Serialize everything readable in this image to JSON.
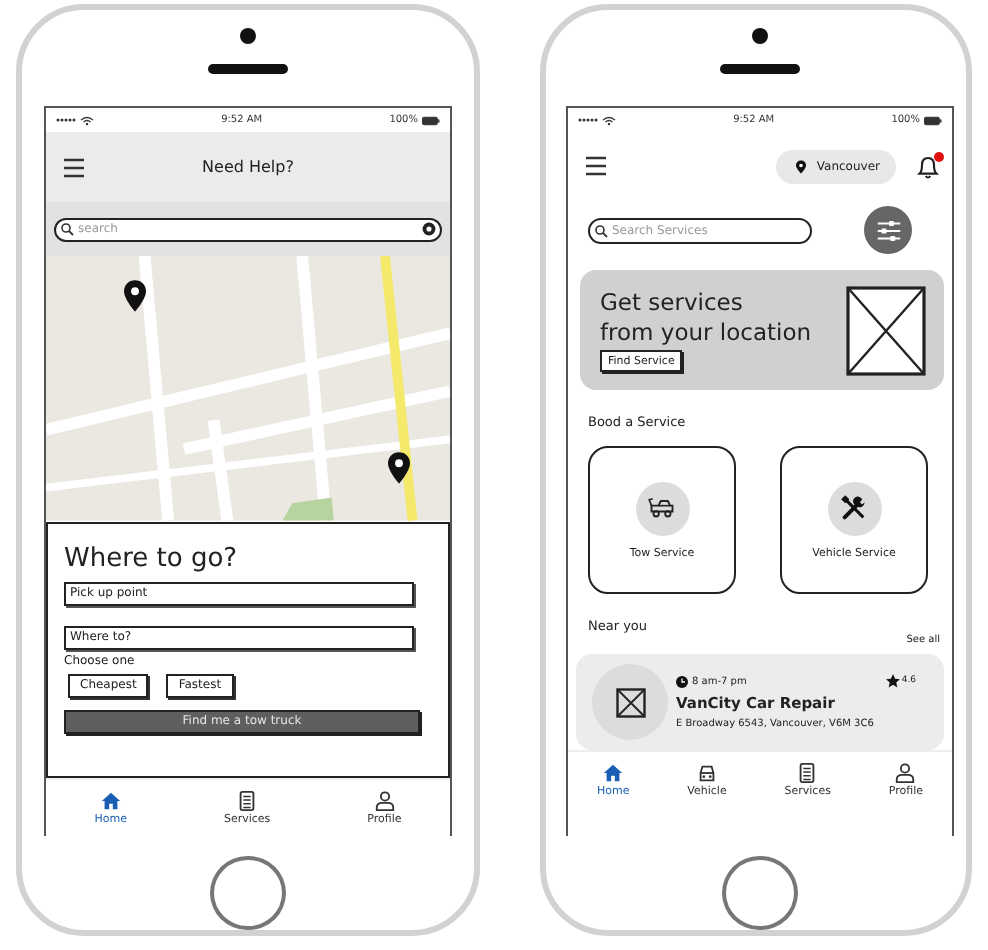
{
  "phones": [
    {
      "kind": "find_truck",
      "status_bar": {
        "time": "9:52 AM",
        "battery": "100%"
      },
      "title": "Need Help?",
      "search": {
        "placeholder": "search"
      },
      "sheet": {
        "heading": "Where to go?",
        "fields": [
          {
            "placeholder": "Pick up point"
          },
          {
            "placeholder": "Where to?"
          }
        ],
        "choice_label": "Choose one",
        "options": [
          "Cheapest",
          "Fastest"
        ],
        "action": "Find me a tow truck"
      },
      "nav": [
        {
          "kind": "home",
          "label": "Home",
          "selected": true
        },
        {
          "kind": "services",
          "label": "Services",
          "selected": false
        },
        {
          "kind": "profile",
          "label": "Profile",
          "selected": false
        }
      ]
    },
    {
      "kind": "services",
      "status_bar": {
        "time": "9:52 AM",
        "battery": "100%"
      },
      "location": "Vancouver",
      "notification": true,
      "search": {
        "placeholder": "Search Services"
      },
      "banner": {
        "heading_lines": [
          "Get services",
          "from your location"
        ],
        "button": "Find Service"
      },
      "section_title": "Bood a Service",
      "services": [
        {
          "kind": "tow",
          "label": "Tow Service"
        },
        {
          "kind": "repair",
          "label": "Vehicle Service"
        }
      ],
      "nearby_title": "Near you",
      "see_all": "See all",
      "places": [
        {
          "hours": "8 am-7 pm",
          "rating": "4.6",
          "name": "VanCity Car Repair",
          "address": "E Broadway 6543, Vancouver, V6M 3C6"
        }
      ],
      "nav": [
        {
          "kind": "home",
          "label": "Home",
          "selected": true
        },
        {
          "kind": "vehicle",
          "label": "Vehicle",
          "selected": false
        },
        {
          "kind": "services",
          "label": "Services",
          "selected": false
        },
        {
          "kind": "profile",
          "label": "Profile",
          "selected": false
        }
      ]
    }
  ]
}
